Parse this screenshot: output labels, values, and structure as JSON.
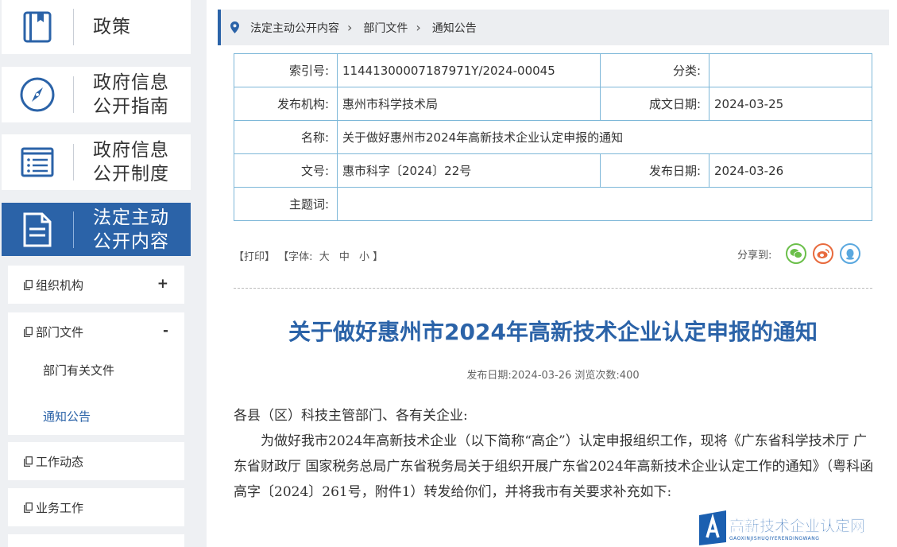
{
  "sidebar": {
    "nav": [
      {
        "label": "政策",
        "icon": "book-icon"
      },
      {
        "label": "政府信息\n公开指南",
        "icon": "compass-icon"
      },
      {
        "label": "政府信息\n公开制度",
        "icon": "list-document-icon"
      },
      {
        "label": "法定主动\n公开内容",
        "icon": "document-icon"
      }
    ],
    "sub": {
      "org": {
        "label": "组织机构",
        "toggle": "+"
      },
      "dept": {
        "label": "部门文件",
        "toggle": "-"
      },
      "dept_children": [
        "部门有关文件",
        "通知公告"
      ],
      "work_news": {
        "label": "工作动态"
      },
      "business": {
        "label": "业务工作"
      }
    }
  },
  "breadcrumb": [
    "法定主动公开内容",
    "部门文件",
    "通知公告"
  ],
  "info": {
    "index_no_label": "索引号:",
    "index_no": "11441300007187971Y/2024-00045",
    "category_label": "分类:",
    "category": "",
    "issuer_label": "发布机构:",
    "issuer": "惠州市科学技术局",
    "created_label": "成文日期:",
    "created": "2024-03-25",
    "name_label": "名称:",
    "name": "关于做好惠州市2024年高新技术企业认定申报的通知",
    "doc_no_label": "文号:",
    "doc_no": "惠市科字〔2024〕22号",
    "published_label": "发布日期:",
    "published": "2024-03-26",
    "keywords_label": "主题词:",
    "keywords": ""
  },
  "tools": {
    "print": "【打印】",
    "font_label": "【字体:",
    "font_large": "大",
    "font_medium": "中",
    "font_small": "小",
    "font_close": "】",
    "share_label": "分享到:"
  },
  "article": {
    "title": "关于做好惠州市2024年高新技术企业认定申报的通知",
    "meta": "发布日期:2024-03-26  浏览次数:400",
    "greeting": "各县（区）科技主管部门、各有关企业:",
    "para1": "为做好我市2024年高新技术企业（以下简称“高企”）认定申报组织工作，现将《广东省科学技术厅 广东省财政厅 国家税务总局广东省税务局关于组织开展广东省2024年高新技术企业认定工作的通知》（粤科函高字〔2024〕261号，附件1）转发给你们，并将我市有关要求补充如下:"
  },
  "watermark": {
    "title": "高新技术企业认定网",
    "sub": "GAOXINJISHUQIYERENDINGWANG"
  },
  "colors": {
    "brand": "#2b63a8",
    "table_border": "#7db7d8",
    "wechat": "#6bbf4a",
    "weibo": "#e86a3d",
    "qq": "#5aa8df"
  }
}
